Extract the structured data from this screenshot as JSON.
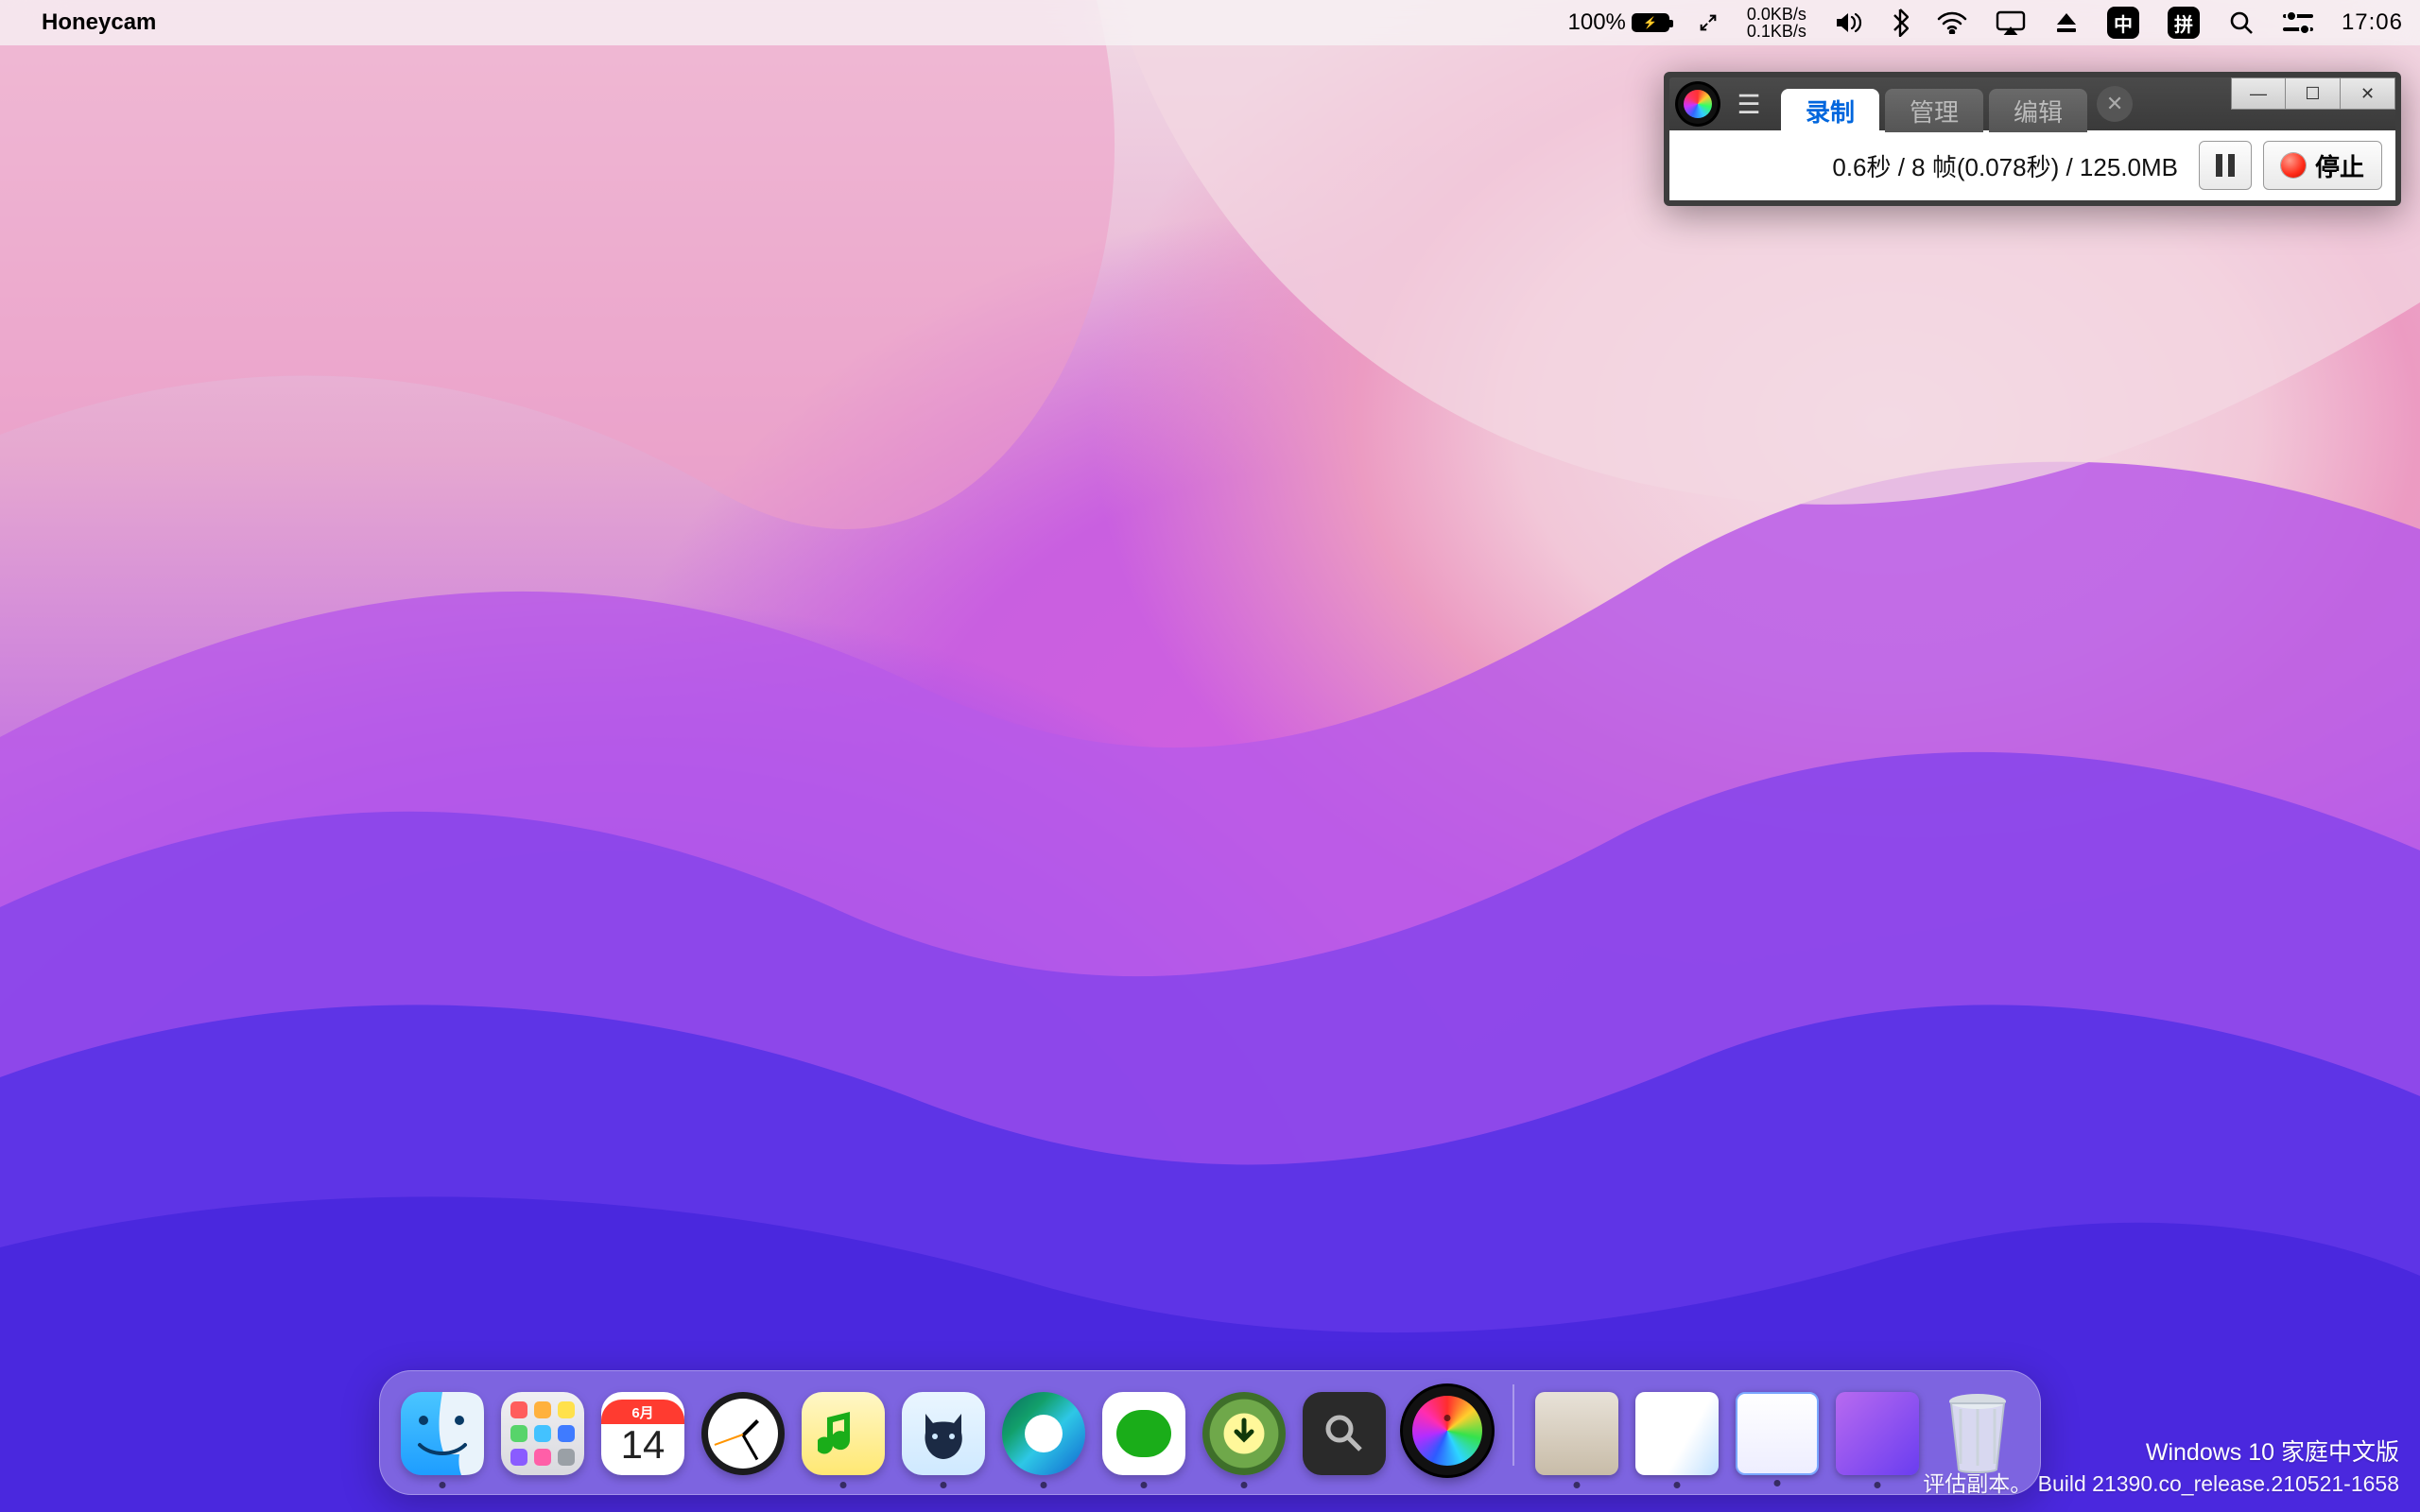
{
  "menubar": {
    "app_name": "Honeycam",
    "battery_pct": "100%",
    "netspeed_up": "0.0KB/s",
    "netspeed_down": "0.1KB/s",
    "ime1": "中",
    "ime2": "拼",
    "clock": "17:06"
  },
  "honeycam": {
    "tabs": {
      "record": "录制",
      "manage": "管理",
      "edit": "编辑"
    },
    "status": "0.6秒 / 8 帧(0.078秒) / 125.0MB",
    "stop_label": "停止"
  },
  "dock": {
    "calendar_month": "6月",
    "calendar_day": "14",
    "launchpad_colors": [
      "#ff5d5d",
      "#ffb13d",
      "#ffe14b",
      "#57d46a",
      "#43c2ff",
      "#3f7bff",
      "#8a5cff",
      "#ff5fa8",
      "#9aa0a6"
    ]
  },
  "watermark": {
    "line1": "Windows 10 家庭中文版",
    "line2": "评估副本。 Build 21390.co_release.210521-1658"
  }
}
